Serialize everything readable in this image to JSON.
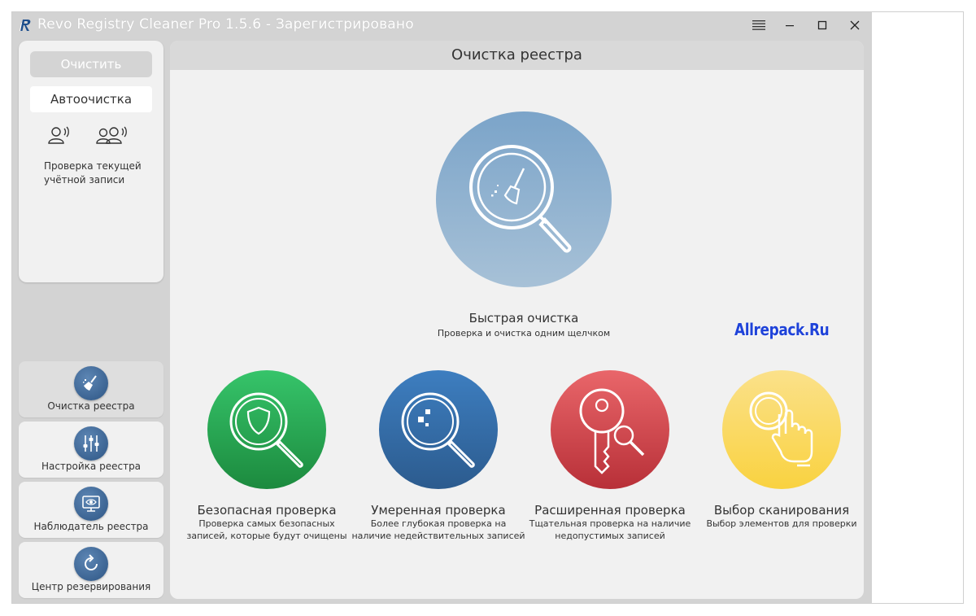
{
  "window": {
    "title": "Revo Registry Cleaner Pro 1.5.6 - Зарегистрировано"
  },
  "sidebar": {
    "clean_label": "Очистить",
    "auto_label": "Автоочистка",
    "account_text": "Проверка текущей учётной записи",
    "nav": [
      {
        "label": "Очистка реестра",
        "icon": "broom-icon",
        "active": true
      },
      {
        "label": "Настройка реестра",
        "icon": "sliders-icon",
        "active": false
      },
      {
        "label": "Наблюдатель реестра",
        "icon": "monitor-eye-icon",
        "active": false
      },
      {
        "label": "Центр резервирования",
        "icon": "backup-refresh-icon",
        "active": false
      }
    ]
  },
  "main": {
    "header": "Очистка реестра",
    "quick": {
      "title": "Быстрая очистка",
      "subtitle": "Проверка и очистка одним щелчком"
    },
    "options": [
      {
        "title": "Безопасная проверка",
        "subtitle": "Проверка самых безопасных записей, которые будут очищены",
        "color": "#2aa853"
      },
      {
        "title": "Умеренная проверка",
        "subtitle": "Более глубокая проверка на наличие недействительных записей",
        "color": "#3470aa"
      },
      {
        "title": "Расширенная проверка",
        "subtitle": "Тщательная проверка на наличие недопустимых записей",
        "color": "#d14a50"
      },
      {
        "title": "Выбор сканирования",
        "subtitle": "Выбор элементов для проверки",
        "color": "#fad95c"
      }
    ]
  },
  "watermark": "Allrepack.Ru"
}
